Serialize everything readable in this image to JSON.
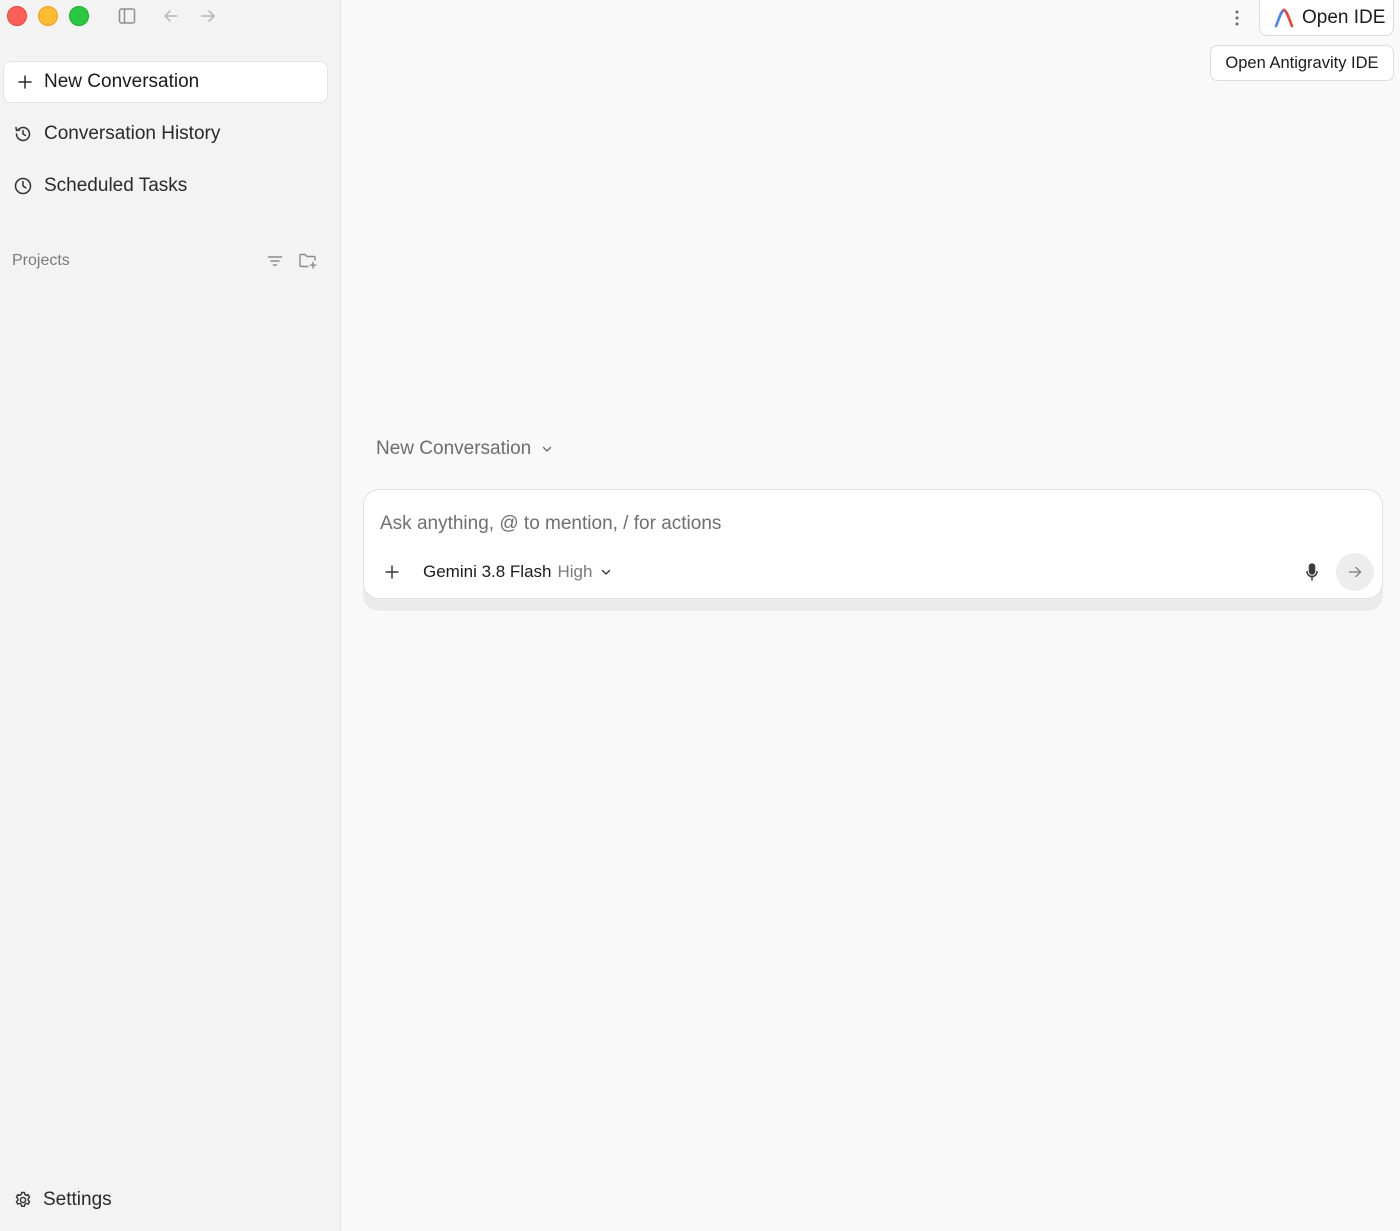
{
  "sidebar": {
    "new_conversation": "New Conversation",
    "items": [
      {
        "label": "Conversation History",
        "icon": "history-icon"
      },
      {
        "label": "Scheduled Tasks",
        "icon": "clock-icon"
      }
    ],
    "projects_label": "Projects",
    "settings_label": "Settings"
  },
  "header": {
    "open_ide_label": "Open IDE",
    "tooltip": "Open Antigravity IDE"
  },
  "main": {
    "conversation_selector": "New Conversation",
    "prompt_placeholder": "Ask anything, @ to mention, / for actions",
    "model_name": "Gemini 3.8 Flash",
    "model_level": "High"
  },
  "colors": {
    "traffic_red": "#ff5f57",
    "traffic_yellow": "#febc2e",
    "traffic_green": "#28c840",
    "logo_blue": "#4285f4",
    "logo_red": "#ea4335"
  }
}
